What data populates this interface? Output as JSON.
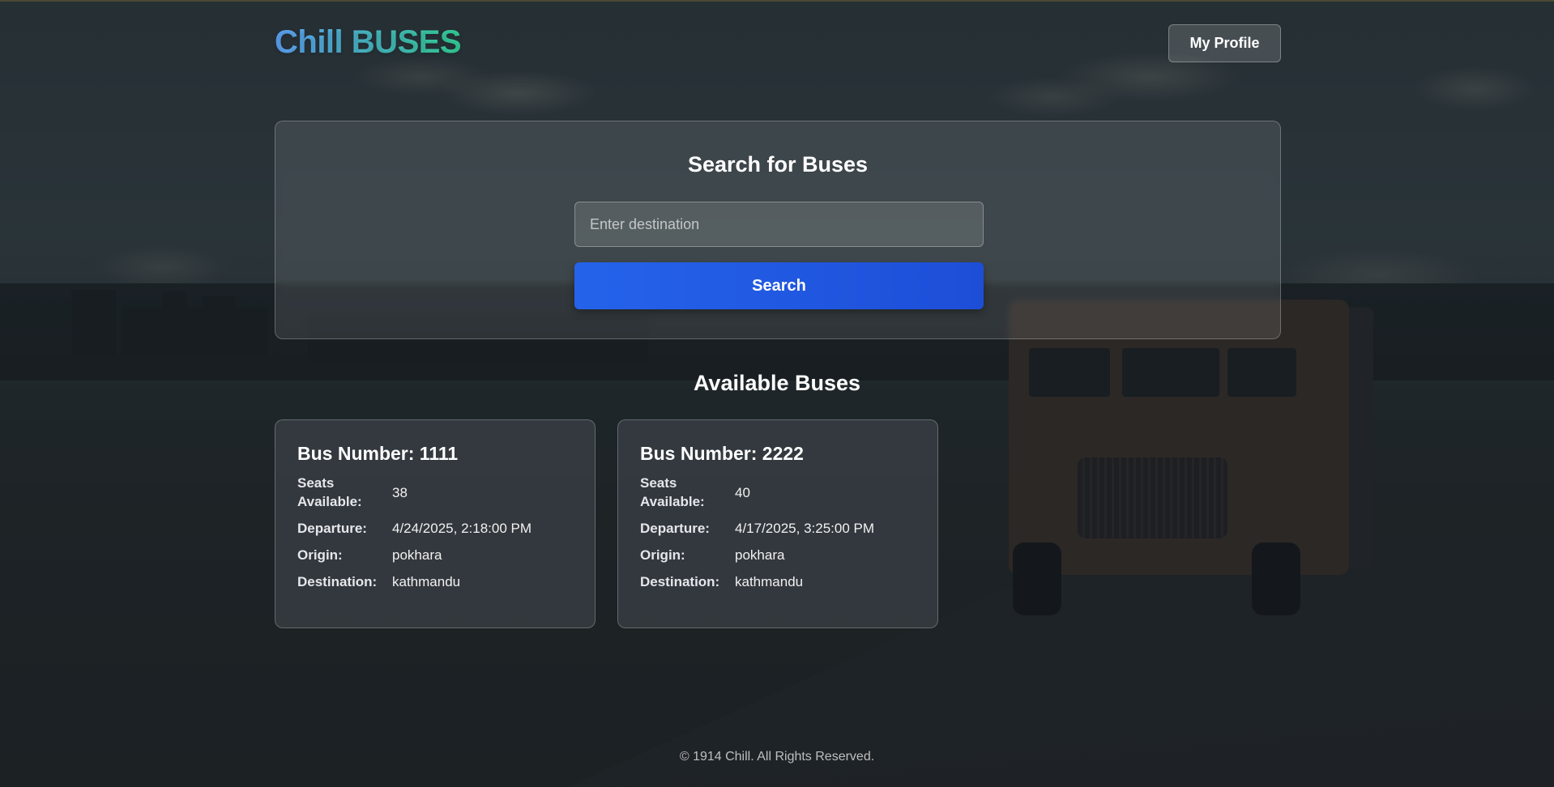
{
  "header": {
    "logo_part1": "Chill",
    "logo_part2": "BUSES",
    "profile_label": "My Profile"
  },
  "search": {
    "title": "Search for Buses",
    "placeholder": "Enter destination",
    "value": "",
    "button_label": "Search"
  },
  "results": {
    "title": "Available Buses",
    "labels": {
      "seats": "Seats Available:",
      "departure": "Departure:",
      "origin": "Origin:",
      "destination": "Destination:"
    },
    "buses": [
      {
        "heading": "Bus Number: 1111",
        "seats": "38",
        "departure": "4/24/2025, 2:18:00 PM",
        "origin": "pokhara",
        "destination": "kathmandu"
      },
      {
        "heading": "Bus Number: 2222",
        "seats": "40",
        "departure": "4/17/2025, 3:25:00 PM",
        "origin": "pokhara",
        "destination": "kathmandu"
      }
    ]
  },
  "footer": {
    "text": "© 1914 Chill. All Rights Reserved."
  },
  "colors": {
    "primary_button": "#2563eb",
    "logo_gradient_start": "#60a5fa",
    "logo_gradient_end": "#34d399"
  }
}
